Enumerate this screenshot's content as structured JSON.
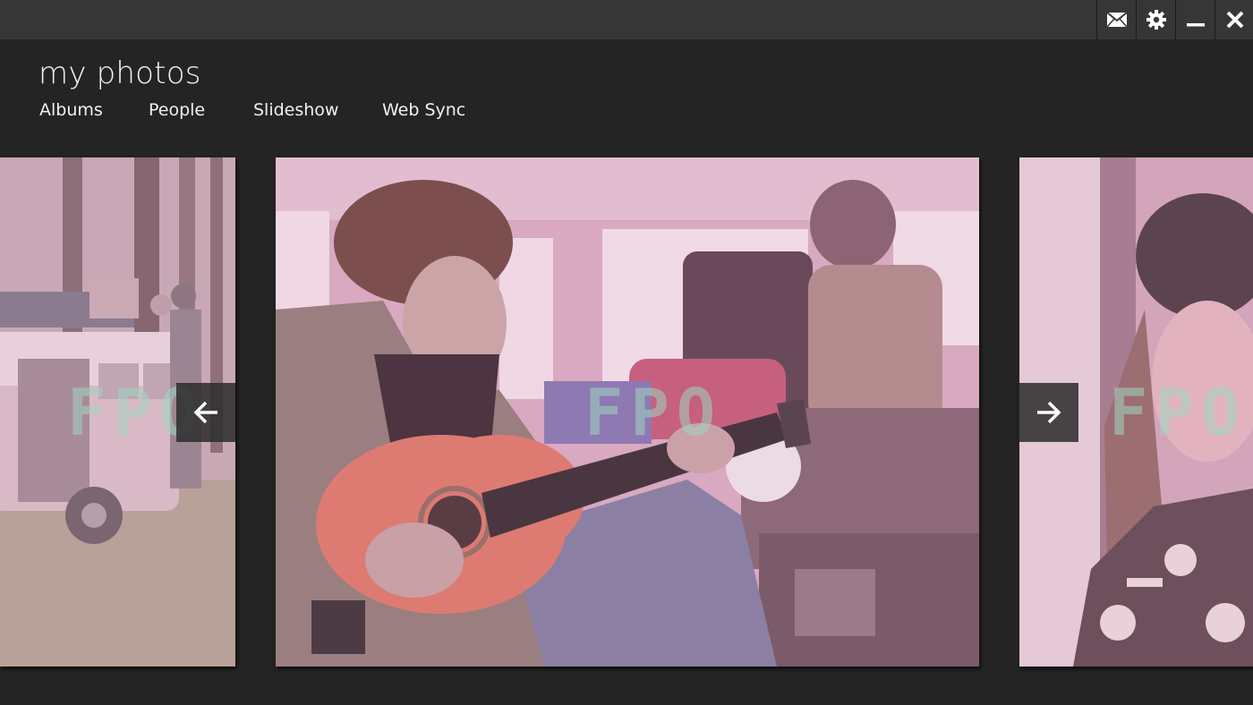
{
  "window": {
    "controls": [
      {
        "name": "mail-icon"
      },
      {
        "name": "gear-icon"
      },
      {
        "name": "minimize-icon"
      },
      {
        "name": "close-icon"
      }
    ]
  },
  "app": {
    "title": "my photos"
  },
  "nav": [
    {
      "label": "Albums"
    },
    {
      "label": "People"
    },
    {
      "label": "Slideshow"
    },
    {
      "label": "Web Sync"
    }
  ],
  "carousel": {
    "photos": [
      {
        "placeholder": "FPO",
        "subject": "people unloading a vintage van in a forest"
      },
      {
        "placeholder": "FPO",
        "subject": "young man playing guitar inside a van"
      },
      {
        "placeholder": "FPO",
        "subject": "young woman in knit hat looking out a window"
      }
    ],
    "prev_icon": "arrow-left-icon",
    "next_icon": "arrow-right-icon"
  },
  "colors": {
    "background": "#242424",
    "titlebar": "#363636",
    "photo_tint": "#d98bb0",
    "fpo_text": "#9fd6c0"
  }
}
